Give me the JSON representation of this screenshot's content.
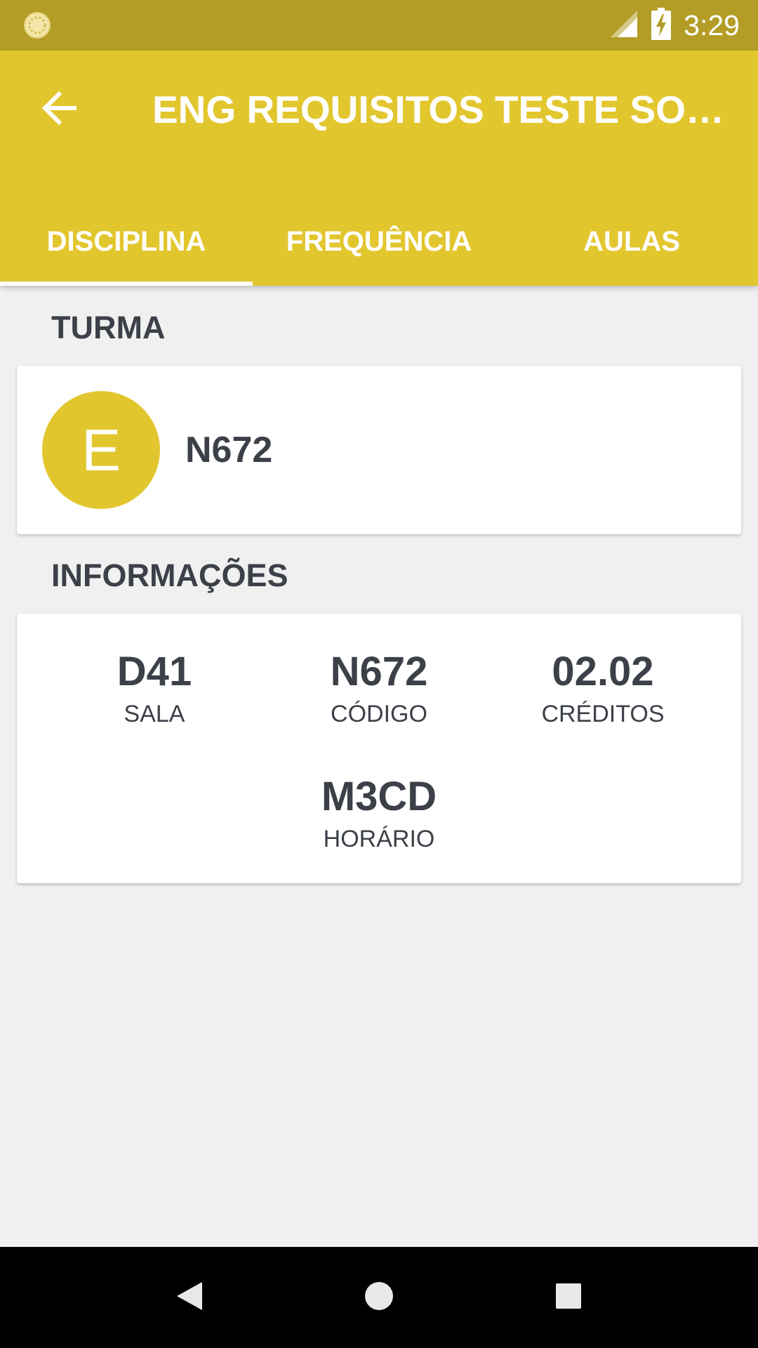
{
  "status_bar": {
    "time": "3:29",
    "icons": [
      "app-notification-icon",
      "cell-signal-icon",
      "battery-charging-icon"
    ]
  },
  "toolbar": {
    "back_icon": "arrow-left-icon",
    "title": "ENG REQUISITOS TESTE SOFTWARE"
  },
  "tabs": [
    {
      "label": "DISCIPLINA",
      "selected": true
    },
    {
      "label": "FREQUÊNCIA",
      "selected": false
    },
    {
      "label": "AULAS",
      "selected": false
    }
  ],
  "turma": {
    "section_title": "TURMA",
    "avatar_letter": "E",
    "name": "N672"
  },
  "informacoes": {
    "section_title": "INFORMAÇÕES",
    "items": [
      {
        "value": "D41",
        "label": "SALA"
      },
      {
        "value": "N672",
        "label": "CÓDIGO"
      },
      {
        "value": "02.02",
        "label": "CRÉDITOS"
      },
      {
        "value": "M3CD",
        "label": "HORÁRIO"
      }
    ]
  },
  "nav_bar": {
    "icons": [
      "back-triangle-icon",
      "home-circle-icon",
      "recents-square-icon"
    ]
  },
  "colors": {
    "accent": "#e2c62e",
    "status_bar": "#b39d27",
    "text_dark": "#3c4048",
    "background": "#f0f0f0"
  }
}
